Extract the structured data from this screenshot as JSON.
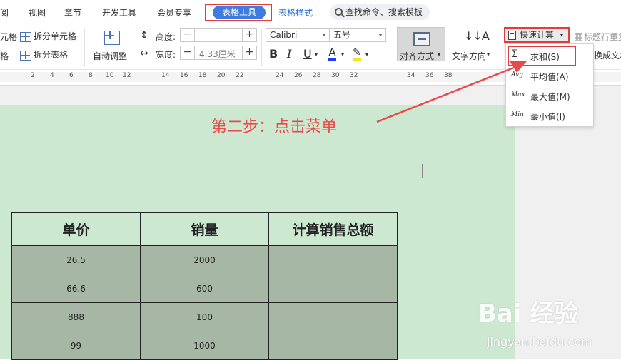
{
  "menu_tabs": [
    "阅",
    "视图",
    "章节",
    "开发工具",
    "会员专享",
    "表格工具",
    "表格样式"
  ],
  "active_tab": "表格工具",
  "search": {
    "label": "查找命令、搜索模板"
  },
  "ribbon": {
    "partial_left_1": "元格",
    "partial_left_2": "格",
    "split_cell": "拆分单元格",
    "split_table": "拆分表格",
    "auto_adjust": "自动调整",
    "height_label": "高度:",
    "height_value": "",
    "width_label": "宽度:",
    "width_value": "4.33厘米",
    "font_name": "Calibri",
    "font_size": "五号",
    "bold": "B",
    "italic": "I",
    "underline": "U",
    "font_color": "A",
    "align": "对齐方式",
    "text_direction": "文字方向",
    "quick_calc": "快速计算",
    "repeat_header": "标题行重复",
    "convert_text": "换成文本"
  },
  "ruler": {
    "numbers": [
      "2",
      "4",
      "6",
      "8",
      "10",
      "12",
      "14",
      "16",
      "18",
      "20",
      "22",
      "24",
      "26",
      "28",
      "30",
      "32",
      "34",
      "36",
      "38"
    ]
  },
  "dropdown": {
    "items": [
      {
        "icon": "Σ",
        "label": "求和(S)"
      },
      {
        "icon": "Avg",
        "label": "平均值(A)"
      },
      {
        "icon": "Max",
        "label": "最大值(M)"
      },
      {
        "icon": "Min",
        "label": "最小值(I)"
      }
    ]
  },
  "annotation": "第二步：点击菜单",
  "table": {
    "headers": [
      "单价",
      "销量",
      "计算销售总额"
    ],
    "rows": [
      [
        "26.5",
        "2000",
        ""
      ],
      [
        "66.6",
        "600",
        ""
      ],
      [
        "888",
        "100",
        ""
      ],
      [
        "99",
        "1000",
        ""
      ]
    ]
  },
  "watermark": {
    "logo": "Bai 经验",
    "url": "jingyan.baidu.com"
  },
  "colors": {
    "accent": "#3d7be0",
    "highlight_border": "#e43b3b",
    "page_bg": "#cde8d0",
    "cell_bg": "#a6b7a5",
    "annotation": "#e84a4a"
  }
}
